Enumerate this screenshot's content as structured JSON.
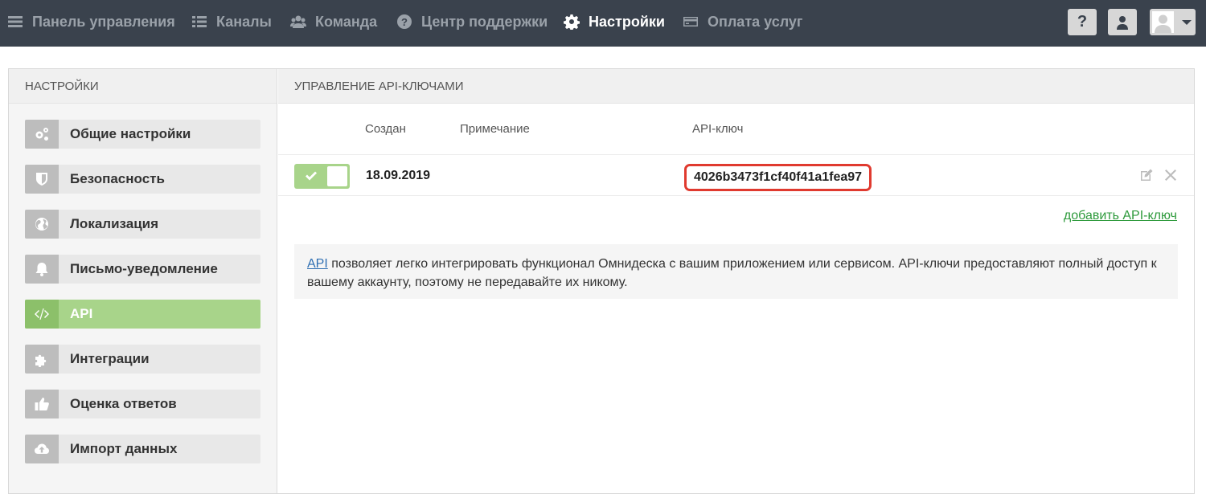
{
  "topnav": {
    "items": [
      {
        "label": "Панель управления",
        "icon": "dashboard-icon"
      },
      {
        "label": "Каналы",
        "icon": "list-icon"
      },
      {
        "label": "Команда",
        "icon": "team-icon"
      },
      {
        "label": "Центр поддержки",
        "icon": "help-circle-icon"
      },
      {
        "label": "Настройки",
        "icon": "gear-icon",
        "active": true
      },
      {
        "label": "Оплата услуг",
        "icon": "credit-card-icon"
      }
    ],
    "help_btn": "?"
  },
  "sidebar": {
    "title": "НАСТРОЙКИ",
    "items": [
      {
        "label": "Общие настройки",
        "icon": "gears-icon"
      },
      {
        "label": "Безопасность",
        "icon": "shield-icon"
      },
      {
        "label": "Локализация",
        "icon": "globe-icon"
      },
      {
        "label": "Письмо-уведомление",
        "icon": "bell-icon"
      },
      {
        "label": "API",
        "icon": "code-icon",
        "active": true
      },
      {
        "label": "Интеграции",
        "icon": "puzzle-icon"
      },
      {
        "label": "Оценка ответов",
        "icon": "thumbs-up-icon"
      },
      {
        "label": "Импорт данных",
        "icon": "cloud-upload-icon"
      }
    ]
  },
  "content": {
    "title": "УПРАВЛЕНИЕ API-КЛЮЧАМИ",
    "table": {
      "headers": [
        "Создан",
        "Примечание",
        "API-ключ"
      ],
      "rows": [
        {
          "enabled": true,
          "created": "18.09.2019",
          "note": "",
          "api_key": "4026b3473f1cf40f41a1fea97"
        }
      ]
    },
    "add_link": "добавить API-ключ",
    "info": {
      "link": "API",
      "text": " позволяет легко интегрировать функционал Омнидеска с вашим приложением или сервисом. API-ключи предоставляют полный доступ к вашему аккаунту, поэтому не передавайте их никому."
    }
  },
  "colors": {
    "topbar": "#3a424d",
    "accent_green": "#a8d48a",
    "highlight_red": "#e03a2f",
    "link_green": "#2e9a3c"
  }
}
